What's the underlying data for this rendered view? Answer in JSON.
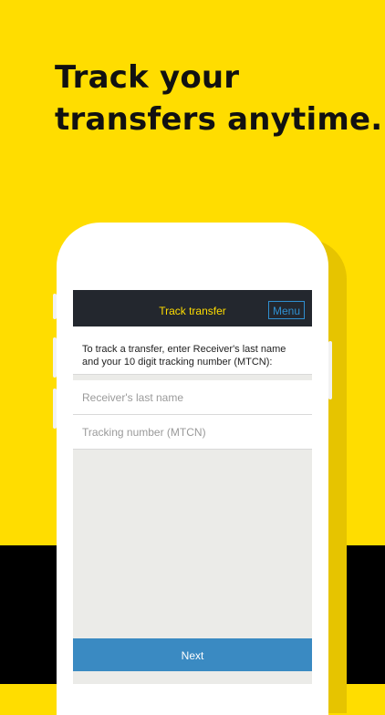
{
  "headline": {
    "line1": "Track your",
    "line2": "transfers anytime."
  },
  "app": {
    "nav_title": "Track transfer",
    "menu_label": "Menu",
    "instructions": "To track a transfer, enter Receiver's last name and your 10 digit tracking number (MTCN):",
    "receiver_field": {
      "placeholder": "Receiver's last name",
      "value": ""
    },
    "mtcn_field": {
      "placeholder": "Tracking number (MTCN)",
      "value": ""
    },
    "next_label": "Next"
  },
  "colors": {
    "background": "#ffdd00",
    "navbar": "#23272e",
    "accent_text": "#ffdd00",
    "link_blue": "#2f8fd0",
    "button_blue": "#3a8ac2"
  }
}
